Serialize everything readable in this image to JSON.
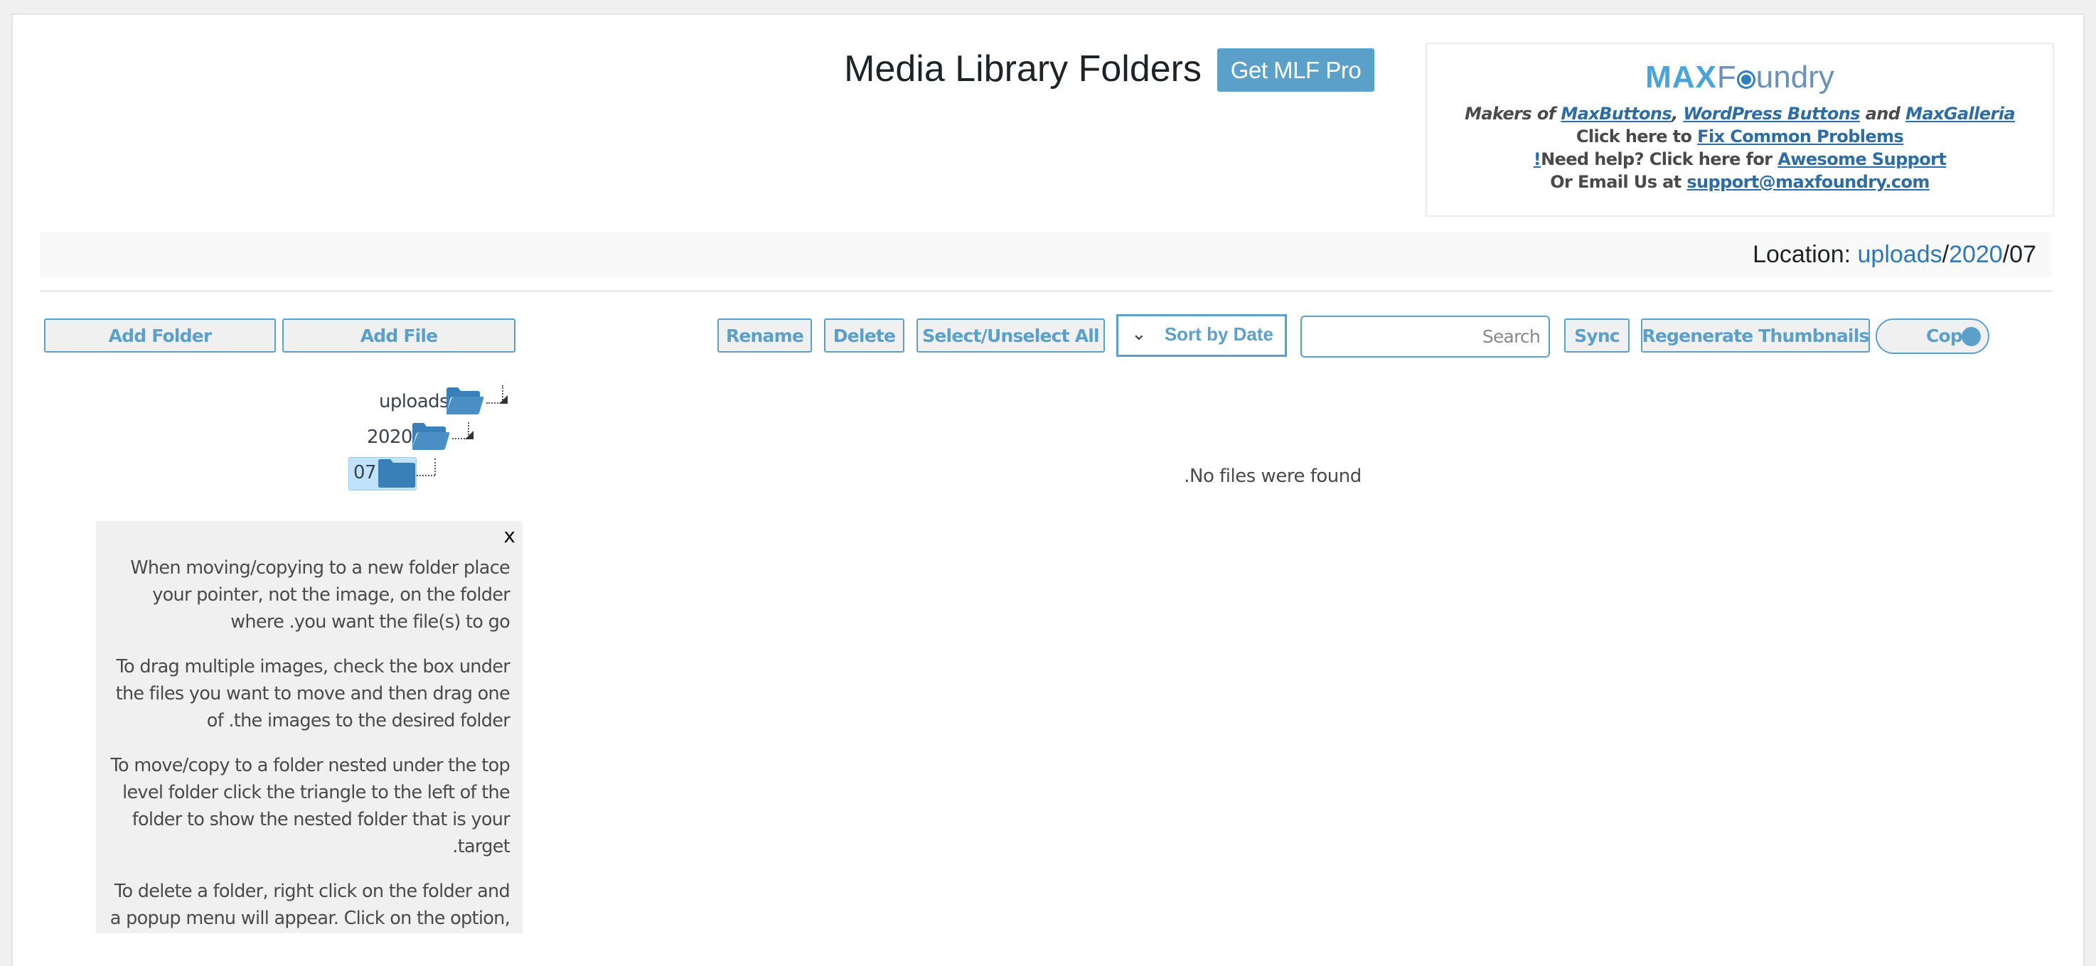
{
  "header": {
    "title": "Media Library Folders",
    "pro_button": "Get MLF Pro"
  },
  "info_box": {
    "logo": {
      "max": "MAX",
      "f": "F",
      "rest": "undry"
    },
    "line1": {
      "prefix": "Makers of ",
      "link1": "MaxButtons",
      "sep": ", ",
      "link2": "WordPress Buttons",
      "and": " and ",
      "link3": "MaxGalleria"
    },
    "line2": {
      "prefix": "Click here to ",
      "link": "Fix Common Problems"
    },
    "line3": {
      "bang": "!",
      "prefix": "Need help? Click here for ",
      "link": "Awesome Support"
    },
    "line4": {
      "prefix": "Or Email Us at ",
      "link": "support@maxfoundry.com"
    }
  },
  "location": {
    "label": "Location: ",
    "crumbs": [
      "uploads",
      "2020",
      "07"
    ],
    "sep": "/"
  },
  "toolbar": {
    "add_folder": "Add Folder",
    "add_file": "Add File",
    "rename": "Rename",
    "delete": "Delete",
    "select_all": "Select/Unselect All",
    "sort_selected": "Sort by Date",
    "search_placeholder": "Search",
    "search_value": "",
    "sync": "Sync",
    "regenerate": "Regenerate Thumbnails",
    "copy_toggle": "Cop",
    "copy_toggle_on": true
  },
  "tree": {
    "nodes": [
      {
        "label": "uploads",
        "level": 0,
        "expanded": true,
        "selected": false
      },
      {
        "label": "2020",
        "level": 1,
        "expanded": true,
        "selected": false
      },
      {
        "label": "07",
        "level": 2,
        "expanded": false,
        "selected": true
      }
    ]
  },
  "files": {
    "empty_message": ".No files were found"
  },
  "help": {
    "close": "x",
    "paragraphs": [
      "When moving/copying to a new folder place your pointer, not the image, on the folder where .you want the file(s) to go",
      "To drag multiple images, check the box under the files you want to move and then drag one of .the images to the desired folder",
      "To move/copy to a folder nested under the top level folder click the triangle to the left of the folder to show the nested folder that is your .target",
      "To delete a folder, right click on the folder and a popup menu will appear. Click on the option,"
    ]
  },
  "colors": {
    "accent": "#5ba0c8",
    "link": "#2e6da4",
    "folder": "#3a80b8",
    "selected_bg": "#bfe3fb"
  }
}
